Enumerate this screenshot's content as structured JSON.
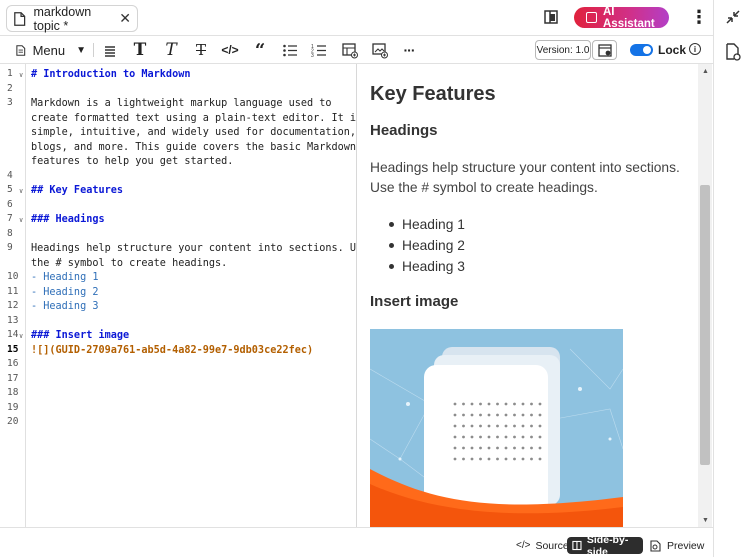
{
  "tab": {
    "title": "markdown topic *",
    "close_glyph": "✕"
  },
  "top_actions": {
    "ai_assistant_label": "AI Assistant",
    "more_glyph": "⋮"
  },
  "toolbar": {
    "menu_label": "Menu",
    "buttons": [
      "paragraph",
      "bold",
      "italic",
      "strikethrough",
      "code",
      "quote",
      "bulleted-list",
      "numbered-list",
      "insert-table",
      "insert-image",
      "more"
    ],
    "version_label": "Version: 1.0",
    "lock_label": "Lock",
    "lock_on": true
  },
  "editor": {
    "line_numbers": [
      "1",
      "2",
      "3",
      "",
      "",
      "",
      "",
      "4",
      "5",
      "6",
      "7",
      "8",
      "9",
      "",
      "10",
      "11",
      "12",
      "13",
      "14",
      "15",
      "16",
      "17",
      "18",
      "19",
      "20"
    ],
    "active_line": "15",
    "fold_lines": [
      "1",
      "5",
      "7",
      "14"
    ],
    "lines": [
      {
        "num": "1",
        "kind": "h1",
        "text": "# Introduction to Markdown"
      },
      {
        "num": "2",
        "kind": "text",
        "text": ""
      },
      {
        "num": "3",
        "kind": "text",
        "text": "Markdown is a lightweight markup language used to"
      },
      {
        "num": "",
        "kind": "text",
        "text": "create formatted text using a plain-text editor. It is"
      },
      {
        "num": "",
        "kind": "text",
        "text": "simple, intuitive, and widely used for documentation,"
      },
      {
        "num": "",
        "kind": "text",
        "text": "blogs, and more. This guide covers the basic Markdown"
      },
      {
        "num": "",
        "kind": "text",
        "text": "features to help you get started."
      },
      {
        "num": "4",
        "kind": "text",
        "text": ""
      },
      {
        "num": "5",
        "kind": "h2",
        "text": "## Key Features"
      },
      {
        "num": "6",
        "kind": "text",
        "text": ""
      },
      {
        "num": "7",
        "kind": "h2",
        "text": "### Headings"
      },
      {
        "num": "8",
        "kind": "text",
        "text": ""
      },
      {
        "num": "9",
        "kind": "text",
        "text": "Headings help structure your content into sections. Use"
      },
      {
        "num": "",
        "kind": "text",
        "text": "the # symbol to create headings."
      },
      {
        "num": "10",
        "kind": "li",
        "text": "- Heading 1"
      },
      {
        "num": "11",
        "kind": "li",
        "text": "- Heading 2"
      },
      {
        "num": "12",
        "kind": "li",
        "text": "- Heading 3"
      },
      {
        "num": "13",
        "kind": "text",
        "text": ""
      },
      {
        "num": "14",
        "kind": "h2",
        "text": "### Insert image"
      },
      {
        "num": "15",
        "kind": "img",
        "text": "![](GUID-2709a761-ab5d-4a82-99e7-9db03ce22fec)"
      },
      {
        "num": "16",
        "kind": "text",
        "text": ""
      },
      {
        "num": "17",
        "kind": "text",
        "text": ""
      },
      {
        "num": "18",
        "kind": "text",
        "text": ""
      },
      {
        "num": "19",
        "kind": "text",
        "text": ""
      },
      {
        "num": "20",
        "kind": "text",
        "text": ""
      }
    ]
  },
  "preview": {
    "h1": "Key Features",
    "h3_headings": "Headings",
    "paragraph": "Headings help structure your content into sections. Use the # symbol to create headings.",
    "list": [
      "Heading 1",
      "Heading 2",
      "Heading 3"
    ],
    "h3_insert_image": "Insert image"
  },
  "footer": {
    "source_label": "Source",
    "side_by_side_label": "Side-by-side",
    "preview_label": "Preview",
    "active_mode": "Side-by-side"
  },
  "colors": {
    "accent_blue": "#1473e6",
    "heading_markdown": "#0b18d6",
    "list_markdown": "#2f6fb8",
    "image_markdown": "#b35f00",
    "ai_gradient_start": "#e0213c",
    "ai_gradient_end": "#b33fc7"
  }
}
